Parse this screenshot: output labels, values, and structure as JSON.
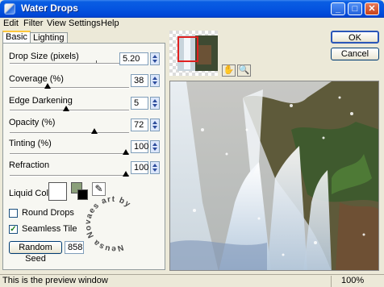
{
  "window": {
    "title": "Water Drops"
  },
  "menu": [
    "Edit",
    "Filter",
    "View",
    "Settings",
    "Help"
  ],
  "tabs": [
    "Basic",
    "Lighting"
  ],
  "controls": [
    {
      "label": "Drop Size (pixels)",
      "value": "5.20",
      "level": 0.8
    },
    {
      "label": "Coverage (%)",
      "value": "38",
      "level": 0.38
    },
    {
      "label": "Edge Darkening",
      "value": "5",
      "level": 0.5
    },
    {
      "label": "Opacity (%)",
      "value": "72",
      "level": 0.72
    },
    {
      "label": "Tinting (%)",
      "value": "100",
      "level": 1.0
    },
    {
      "label": "Refraction",
      "value": "100",
      "level": 1.0
    }
  ],
  "liquid_color": {
    "label": "Liquid Color",
    "swatch": "#ffffff",
    "secondary": "#8ba07a",
    "tertiary": "#000000"
  },
  "checkboxes": [
    {
      "label": "Round Drops",
      "checked": false
    },
    {
      "label": "Seamless Tile",
      "checked": true
    }
  ],
  "random_seed": {
    "button": "Random Seed",
    "value": "858"
  },
  "buttons": {
    "ok": "OK",
    "cancel": "Cancel"
  },
  "watermark": "Neusa Novaes art by",
  "status": {
    "text": "This is the preview window",
    "zoom": "100%"
  }
}
